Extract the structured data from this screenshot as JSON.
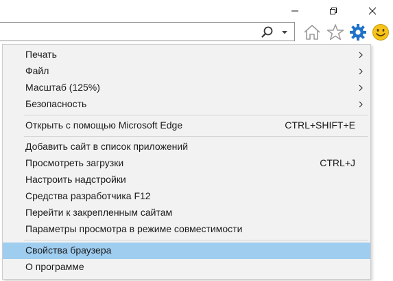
{
  "window_controls": {
    "minimize_icon": "minimize-icon",
    "maximize_icon": "restore-icon",
    "close_icon": "close-icon"
  },
  "toolbar": {
    "icons": [
      "search-icon",
      "chevron-down-icon",
      "home-icon",
      "star-icon",
      "gear-icon",
      "smiley-icon"
    ]
  },
  "menu": {
    "group1": [
      {
        "label": "Печать",
        "submenu": true
      },
      {
        "label": "Файл",
        "submenu": true
      },
      {
        "label": "Масштаб (125%)",
        "submenu": true
      },
      {
        "label": "Безопасность",
        "submenu": true
      }
    ],
    "group2": [
      {
        "label": "Открыть с помощью Microsoft Edge",
        "shortcut": "CTRL+SHIFT+E"
      }
    ],
    "group3": [
      {
        "label": "Добавить сайт в список приложений"
      },
      {
        "label": "Просмотреть загрузки",
        "shortcut": "CTRL+J"
      },
      {
        "label": "Настроить надстройки"
      },
      {
        "label": "Средства разработчика F12"
      },
      {
        "label": "Перейти к закрепленным сайтам"
      },
      {
        "label": "Параметры просмотра в режиме совместимости"
      }
    ],
    "group4": [
      {
        "label": "Свойства браузера",
        "highlighted": true
      },
      {
        "label": "О программе"
      }
    ]
  },
  "colors": {
    "menu_background": "#f2f2f2",
    "highlight": "#9fcdf0",
    "gear_blue": "#1e73c8",
    "smiley_yellow": "#f6c31b"
  }
}
